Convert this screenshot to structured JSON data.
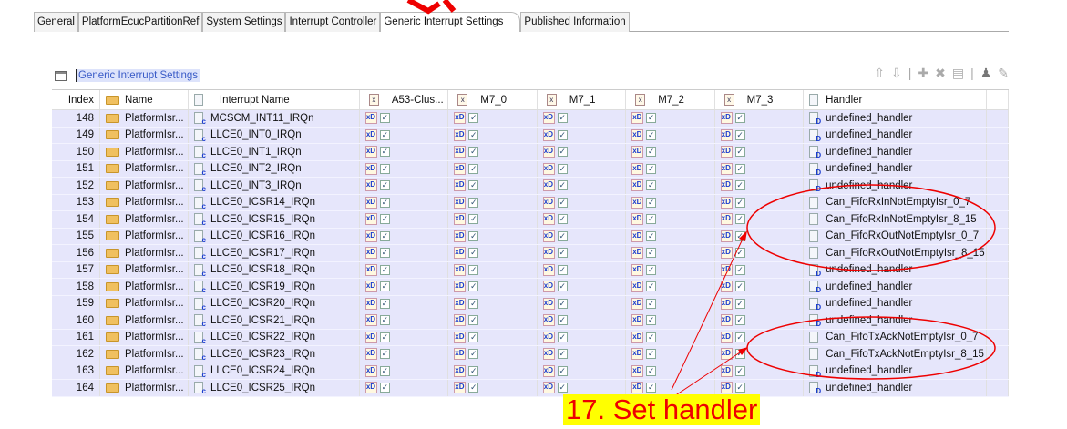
{
  "tabs": [
    "General",
    "PlatformEcucPartitionRef",
    "System Settings",
    "Interrupt Controller",
    "Generic Interrupt Settings",
    "Published Information"
  ],
  "active_tab": "Generic Interrupt Settings",
  "section_title": "Generic Interrupt Settings",
  "toolbar": [
    "move-up-icon",
    "move-down-icon",
    "add-icon",
    "delete-icon",
    "copy-icon",
    "user-icon",
    "edit-icon"
  ],
  "columns": [
    "Index",
    "Name",
    "Interrupt Name",
    "A53-Clus...",
    "M7_0",
    "M7_1",
    "M7_2",
    "M7_3",
    "Handler"
  ],
  "rows": [
    {
      "index": "148",
      "name": "PlatformIsr...",
      "irq": "MCSCM_INT11_IRQn",
      "handler": "undefined_handler"
    },
    {
      "index": "149",
      "name": "PlatformIsr...",
      "irq": "LLCE0_INT0_IRQn",
      "handler": "undefined_handler"
    },
    {
      "index": "150",
      "name": "PlatformIsr...",
      "irq": "LLCE0_INT1_IRQn",
      "handler": "undefined_handler"
    },
    {
      "index": "151",
      "name": "PlatformIsr...",
      "irq": "LLCE0_INT2_IRQn",
      "handler": "undefined_handler"
    },
    {
      "index": "152",
      "name": "PlatformIsr...",
      "irq": "LLCE0_INT3_IRQn",
      "handler": "undefined_handler"
    },
    {
      "index": "153",
      "name": "PlatformIsr...",
      "irq": "LLCE0_ICSR14_IRQn",
      "handler": "Can_FifoRxInNotEmptyIsr_0_7"
    },
    {
      "index": "154",
      "name": "PlatformIsr...",
      "irq": "LLCE0_ICSR15_IRQn",
      "handler": "Can_FifoRxInNotEmptyIsr_8_15"
    },
    {
      "index": "155",
      "name": "PlatformIsr...",
      "irq": "LLCE0_ICSR16_IRQn",
      "handler": "Can_FifoRxOutNotEmptyIsr_0_7"
    },
    {
      "index": "156",
      "name": "PlatformIsr...",
      "irq": "LLCE0_ICSR17_IRQn",
      "handler": "Can_FifoRxOutNotEmptyIsr_8_15"
    },
    {
      "index": "157",
      "name": "PlatformIsr...",
      "irq": "LLCE0_ICSR18_IRQn",
      "handler": "undefined_handler"
    },
    {
      "index": "158",
      "name": "PlatformIsr...",
      "irq": "LLCE0_ICSR19_IRQn",
      "handler": "undefined_handler"
    },
    {
      "index": "159",
      "name": "PlatformIsr...",
      "irq": "LLCE0_ICSR20_IRQn",
      "handler": "undefined_handler"
    },
    {
      "index": "160",
      "name": "PlatformIsr...",
      "irq": "LLCE0_ICSR21_IRQn",
      "handler": "undefined_handler"
    },
    {
      "index": "161",
      "name": "PlatformIsr...",
      "irq": "LLCE0_ICSR22_IRQn",
      "handler": "Can_FifoTxAckNotEmptyIsr_0_7"
    },
    {
      "index": "162",
      "name": "PlatformIsr...",
      "irq": "LLCE0_ICSR23_IRQn",
      "handler": "Can_FifoTxAckNotEmptyIsr_8_15"
    },
    {
      "index": "163",
      "name": "PlatformIsr...",
      "irq": "LLCE0_ICSR24_IRQn",
      "handler": "undefined_handler"
    },
    {
      "index": "164",
      "name": "PlatformIsr...",
      "irq": "LLCE0_ICSR25_IRQn",
      "handler": "undefined_handler"
    }
  ],
  "annotation": "17.  Set handler",
  "colors": {
    "row_bg": "#e6e6fb",
    "annotation_bg": "#ffff00",
    "annotation_text": "#ee0000"
  }
}
